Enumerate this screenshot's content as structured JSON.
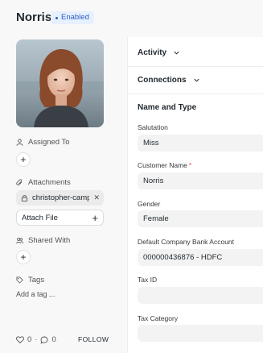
{
  "header": {
    "title": "Norris",
    "status_badge": "Enabled"
  },
  "sidebar": {
    "assigned_to_label": "Assigned To",
    "attachments_label": "Attachments",
    "attachment_file_name": "christopher-camp",
    "attach_file_label": "Attach File",
    "shared_with_label": "Shared With",
    "tags_label": "Tags",
    "add_tag_placeholder": "Add a tag ...",
    "likes_count": "0",
    "separator": "·",
    "comments_count": "0",
    "follow_label": "FOLLOW"
  },
  "main": {
    "activity_label": "Activity",
    "connections_label": "Connections",
    "section_title": "Name and Type",
    "fields": [
      {
        "label": "Salutation",
        "value": "Miss",
        "required": false
      },
      {
        "label": "Customer Name",
        "value": "Norris",
        "required": true,
        "required_mark": "*"
      },
      {
        "label": "Gender",
        "value": "Female",
        "required": false
      },
      {
        "label": "Default Company Bank Account",
        "value": "000000436876 - HDFC",
        "required": false
      },
      {
        "label": "Tax ID",
        "value": "",
        "required": false
      },
      {
        "label": "Tax Category",
        "value": "",
        "required": false
      }
    ]
  },
  "colors": {
    "badge_bg": "#e6f0ff",
    "badge_text": "#2c5cc5",
    "required_star": "#e24c4c"
  }
}
